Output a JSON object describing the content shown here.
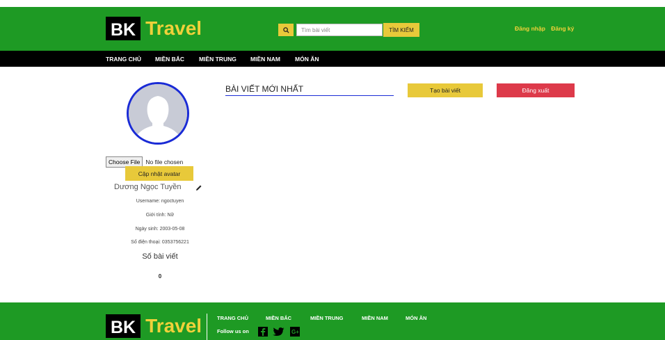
{
  "brand": {
    "bk": "BK",
    "travel": "Travel"
  },
  "search": {
    "placeholder": "Tìm bài viết",
    "button_label": "TÌM KIẾM"
  },
  "auth": {
    "login": "Đăng nhập",
    "register": "Đăng ký"
  },
  "nav": [
    "TRANG CHỦ",
    "MIỀN BẮC",
    "MIỀN TRUNG",
    "MIỀN NAM",
    "MÓN ĂN"
  ],
  "profile": {
    "file_button": "Choose File",
    "file_status": "No file chosen",
    "update_avatar": "Cập nhật avatar",
    "name": "Dương Ngọc Tuyền",
    "username": "Username: ngoctuyen",
    "gender": "Giới tính: Nữ",
    "birthday": "Ngày sinh: 2003-05-08",
    "phone": "Số điện thoại: 0353756221",
    "posts_label": "Số bài viết",
    "posts_count": "0"
  },
  "main": {
    "section_title": "BÀI VIẾT MỚI NHẤT",
    "create_post": "Tạo bài viết",
    "logout": "Đăng xuất"
  },
  "footer": {
    "nav": [
      "TRANG CHỦ",
      "MIỀN BẮC",
      "MIỀN TRUNG",
      "MIỀN NAM",
      "MÓN ĂN"
    ],
    "follow": "Follow us on",
    "social": [
      "facebook-icon",
      "twitter-icon",
      "google-plus-icon"
    ]
  },
  "colors": {
    "primary_green": "#1e9a24",
    "accent_yellow": "#e8c93a",
    "danger_red": "#dd3a4a",
    "navbar_black": "#000000",
    "avatar_border": "#1a2bd6"
  }
}
